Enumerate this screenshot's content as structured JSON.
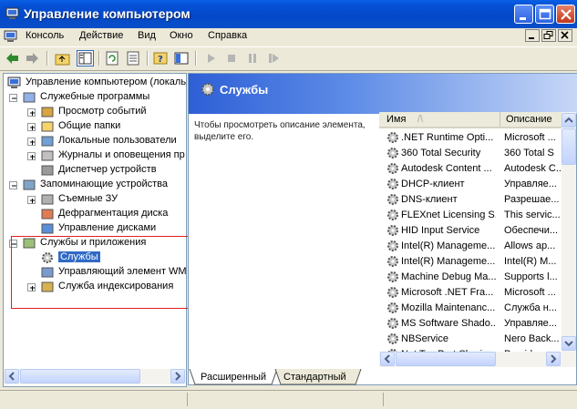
{
  "window": {
    "title": "Управление компьютером",
    "accent": "#0a4fc8",
    "icon": "computer-management-icon",
    "caption_buttons": [
      "minimize-icon",
      "maximize-icon",
      "close-icon"
    ]
  },
  "menu": {
    "items": [
      "Консоль",
      "Действие",
      "Вид",
      "Окно",
      "Справка"
    ]
  },
  "toolbar": {
    "buttons": [
      "back-arrow-icon",
      "forward-arrow-icon",
      "up-folder-icon",
      "show-hide-tree-icon",
      "refresh-icon",
      "export-list-icon",
      "help-icon",
      "mmc-view-icon",
      "play-icon",
      "stop-icon",
      "pause-icon",
      "restart-icon"
    ]
  },
  "tree": {
    "root": "Управление компьютером (локаль",
    "items": [
      {
        "label": "Служебные программы",
        "level": 1,
        "expander": "-"
      },
      {
        "label": "Просмотр событий",
        "level": 2,
        "expander": "+"
      },
      {
        "label": "Общие папки",
        "level": 2,
        "expander": "+"
      },
      {
        "label": "Локальные пользователи",
        "level": 2,
        "expander": "+"
      },
      {
        "label": "Журналы и оповещения пр",
        "level": 2,
        "expander": "+"
      },
      {
        "label": "Диспетчер устройств",
        "level": 2,
        "expander": ""
      },
      {
        "label": "Запоминающие устройства",
        "level": 1,
        "expander": "-"
      },
      {
        "label": "Съемные ЗУ",
        "level": 2,
        "expander": "+"
      },
      {
        "label": "Дефрагментация диска",
        "level": 2,
        "expander": ""
      },
      {
        "label": "Управление дисками",
        "level": 2,
        "expander": ""
      },
      {
        "label": "Службы и приложения",
        "level": 1,
        "expander": "-"
      },
      {
        "label": "Службы",
        "level": 2,
        "expander": "",
        "selected": true
      },
      {
        "label": "Управляющий элемент WM",
        "level": 2,
        "expander": ""
      },
      {
        "label": "Служба индексирования",
        "level": 2,
        "expander": "+"
      }
    ]
  },
  "right": {
    "header": "Службы",
    "description": "Чтобы просмотреть описание элемента, выделите его.",
    "columns": [
      "Имя",
      "Описание"
    ],
    "rows": [
      {
        "name": ".NET Runtime Opti...",
        "desc": "Microsoft ..."
      },
      {
        "name": "360 Total Security",
        "desc": "360 Total S"
      },
      {
        "name": "Autodesk Content ...",
        "desc": "Autodesk C..."
      },
      {
        "name": "DHCP-клиент",
        "desc": "Управляе..."
      },
      {
        "name": "DNS-клиент",
        "desc": "Разрешае..."
      },
      {
        "name": "FLEXnet Licensing S...",
        "desc": "This servic..."
      },
      {
        "name": "HID Input Service",
        "desc": "Обеспечи..."
      },
      {
        "name": "Intel(R) Manageme...",
        "desc": "Allows ap..."
      },
      {
        "name": "Intel(R) Manageme...",
        "desc": "Intel(R) M..."
      },
      {
        "name": "Machine Debug Ma...",
        "desc": "Supports l..."
      },
      {
        "name": "Microsoft .NET Fra...",
        "desc": "Microsoft ..."
      },
      {
        "name": "Mozilla Maintenanc...",
        "desc": "Служба н..."
      },
      {
        "name": "MS Software Shado...",
        "desc": "Управляе..."
      },
      {
        "name": "NBService",
        "desc": "Nero Back..."
      },
      {
        "name": "Net Tcp Port Sharin...",
        "desc": "Provides a..."
      }
    ],
    "tabs": [
      "Расширенный",
      "Стандартный"
    ]
  }
}
